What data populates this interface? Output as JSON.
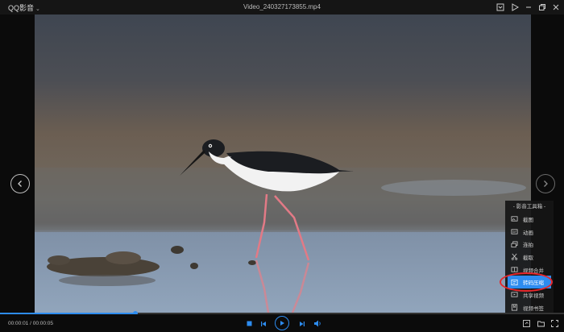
{
  "titlebar": {
    "app_name": "QQ影音",
    "window_title": "Video_240327173855.mp4",
    "icons": [
      "playlist-icon",
      "send-icon",
      "minimize-icon",
      "restore-icon",
      "close-icon"
    ]
  },
  "player": {
    "current_time": "00:00:01",
    "time_separator": " / ",
    "total_time": "00:00:05",
    "progress": 0.24
  },
  "tools_panel": {
    "title": "- 影音工具箱 -",
    "items": [
      {
        "label": "截图",
        "icon": "screenshot-icon"
      },
      {
        "label": "动画",
        "icon": "gif-icon"
      },
      {
        "label": "连拍",
        "icon": "burst-icon"
      },
      {
        "label": "截取",
        "icon": "scissors-icon"
      },
      {
        "label": "视频合并",
        "icon": "merge-icon"
      },
      {
        "label": "转码压缩",
        "icon": "compress-icon",
        "active": true
      },
      {
        "label": "共享视频",
        "icon": "share-icon"
      },
      {
        "label": "视频书签",
        "icon": "bookmark-icon"
      }
    ]
  },
  "colors": {
    "accent": "#2d8cf0",
    "highlight_ring": "#e8262b",
    "background": "#0b0b0b"
  }
}
